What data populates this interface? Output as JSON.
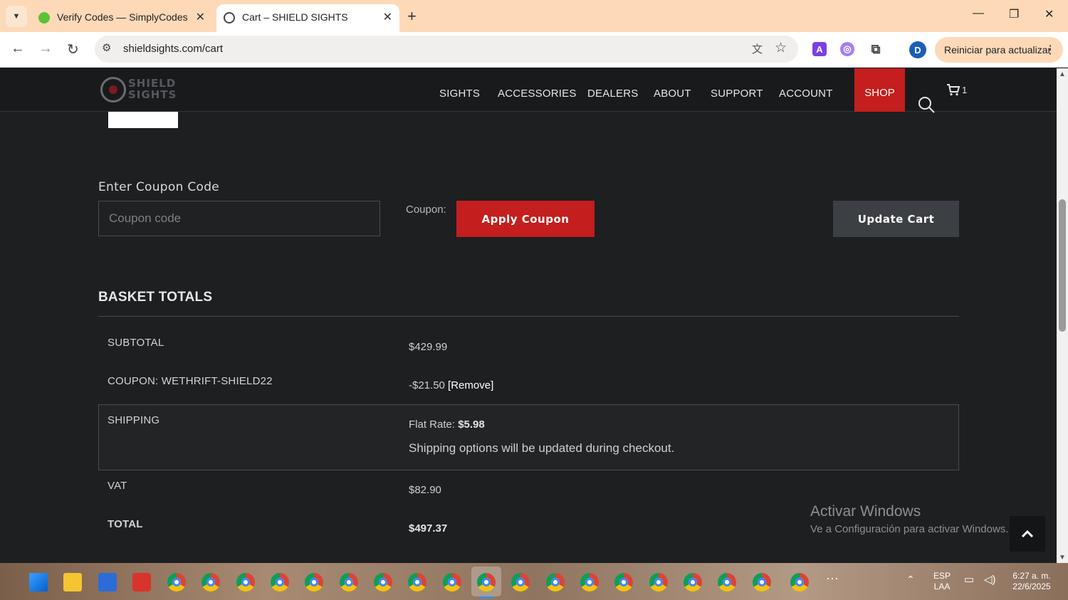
{
  "browser": {
    "tabs": [
      {
        "title": "Verify Codes — SimplyCodes",
        "active": false
      },
      {
        "title": "Cart – SHIELD SIGHTS",
        "active": true
      }
    ],
    "url": "shieldsights.com/cart",
    "update_button": "Reiniciar para actualizar",
    "profile_initial": "D",
    "extension_initial": "A"
  },
  "site": {
    "logo_text": "SHIELD SIGHTS",
    "nav": [
      "SIGHTS",
      "ACCESSORIES",
      "DEALERS",
      "ABOUT",
      "SUPPORT",
      "ACCOUNT"
    ],
    "shop_label": "SHOP",
    "cart_count": "1"
  },
  "coupon": {
    "heading": "Enter Coupon Code",
    "placeholder": "Coupon code",
    "label": "Coupon:",
    "apply_label": "Apply Coupon",
    "update_cart_label": "Update Cart"
  },
  "totals": {
    "heading": "BASKET TOTALS",
    "subtotal_label": "SUBTOTAL",
    "subtotal_value": "$429.99",
    "coupon_label": "COUPON: WETHRIFT-SHIELD22",
    "coupon_value": "-$21.50",
    "remove_label": "[Remove]",
    "shipping_label": "SHIPPING",
    "shipping_prefix": "Flat Rate:",
    "shipping_value": "$5.98",
    "shipping_note": "Shipping options will be updated during checkout.",
    "vat_label": "VAT",
    "vat_value": "$82.90",
    "total_label": "TOTAL",
    "total_value": "$497.37"
  },
  "watermark": {
    "title": "Activar Windows",
    "subtitle": "Ve a Configuración para activar Windows."
  },
  "taskbar": {
    "language": "ESP",
    "region": "LAA",
    "time": "6:27 a. m.",
    "date": "22/6/2025"
  },
  "colors": {
    "brand_red": "#c41e1e",
    "page_bg": "#1d1f21",
    "tab_strip": "#fdd9b8"
  }
}
